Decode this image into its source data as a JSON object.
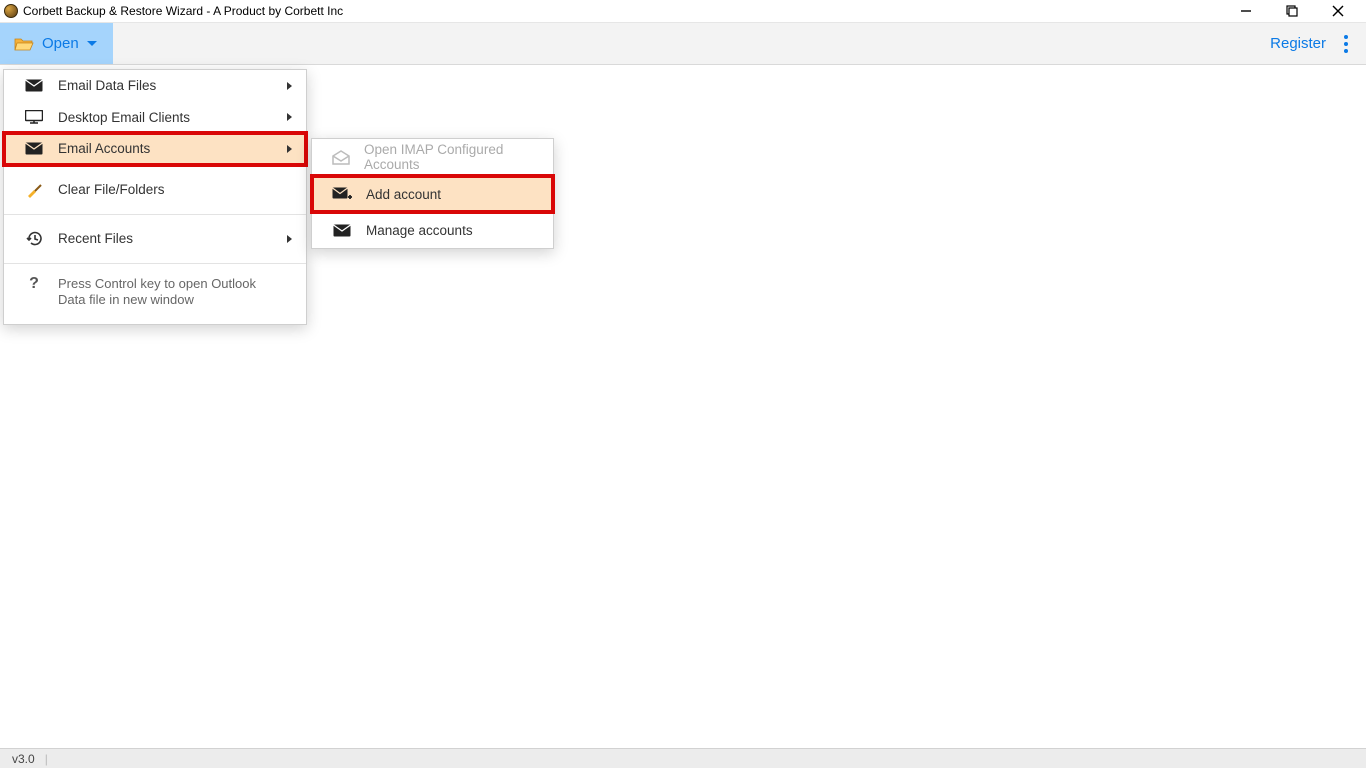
{
  "window": {
    "title": "Corbett Backup & Restore Wizard - A Product by Corbett Inc"
  },
  "toolbar": {
    "open_label": "Open",
    "register_label": "Register"
  },
  "menu": {
    "email_data_files": "Email Data Files",
    "desktop_clients": "Desktop Email Clients",
    "email_accounts": "Email Accounts",
    "clear": "Clear File/Folders",
    "recent": "Recent Files",
    "hint": "Press Control key to open Outlook Data file in new window"
  },
  "submenu": {
    "open_imap": "Open IMAP Configured Accounts",
    "add_account": "Add account",
    "manage_accounts": "Manage accounts"
  },
  "status": {
    "version": "v3.0"
  }
}
